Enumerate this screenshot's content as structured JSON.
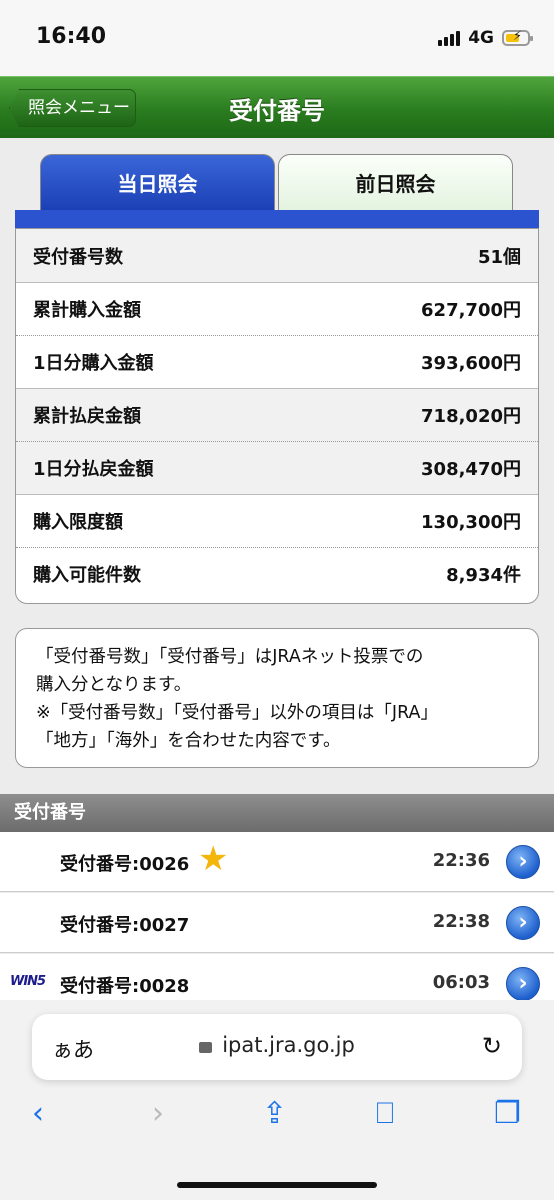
{
  "status": {
    "time": "16:40",
    "network": "4G"
  },
  "header": {
    "back_label": "照会メニュー",
    "title": "受付番号"
  },
  "tabs": [
    {
      "label": "当日照会"
    },
    {
      "label": "前日照会"
    }
  ],
  "summary": [
    {
      "label": "受付番号数",
      "value": "51個"
    },
    {
      "label": "累計購入金額",
      "value": "627,700円"
    },
    {
      "label": "1日分購入金額",
      "value": "393,600円"
    },
    {
      "label": "累計払戻金額",
      "value": "718,020円"
    },
    {
      "label": "1日分払戻金額",
      "value": "308,470円"
    },
    {
      "label": "購入限度額",
      "value": "130,300円"
    },
    {
      "label": "購入可能件数",
      "value": "8,934件"
    }
  ],
  "note": {
    "line1": "「受付番号数」「受付番号」はJRAネット投票での",
    "line2": "購入分となります。",
    "line3": "※「受付番号数」「受付番号」以外の項目は「JRA」",
    "line4": "「地方」「海外」を合わせた内容です。"
  },
  "section_title": "受付番号",
  "list": [
    {
      "label": "受付番号:0026",
      "time": "22:36",
      "badge": ""
    },
    {
      "label": "受付番号:0027",
      "time": "22:38",
      "badge": ""
    },
    {
      "label": "受付番号:0028",
      "time": "06:03",
      "badge": "WIN5"
    }
  ],
  "browser": {
    "aa": "ぁあ",
    "url": "ipat.jra.go.jp"
  },
  "colors": {
    "header_green": "#2a7c1f",
    "tab_blue": "#1a3fb4",
    "arrow_blue": "#1d5fcd",
    "star": "#f5b60c"
  }
}
